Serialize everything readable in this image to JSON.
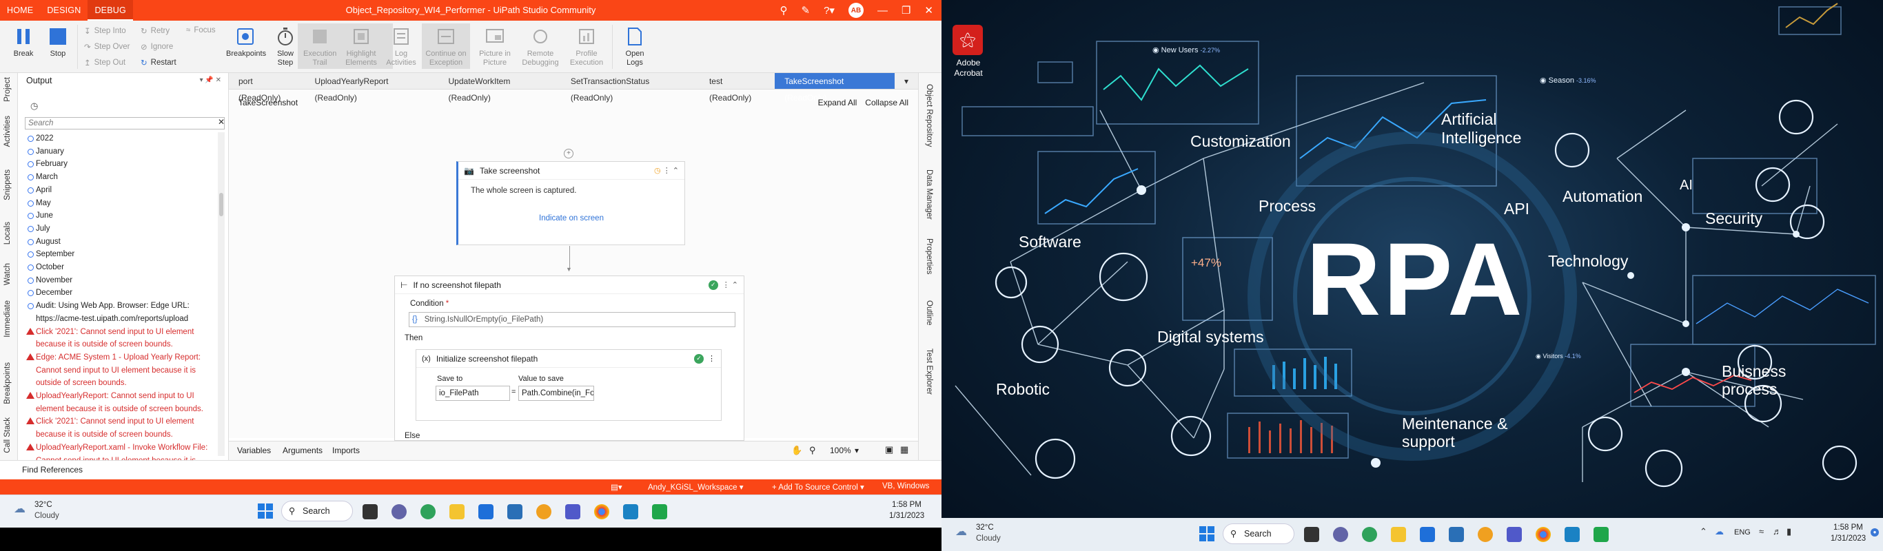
{
  "studio": {
    "tabs": [
      "HOME",
      "DESIGN",
      "DEBUG"
    ],
    "title": "Object_Repository_WI4_Performer - UiPath Studio Community",
    "avatar": "AB",
    "ribbon": {
      "break": "Break",
      "stop": "Stop",
      "step_into": "Step Into",
      "step_over": "Step Over",
      "step_out": "Step Out",
      "retry": "Retry",
      "ignore": "Ignore",
      "restart": "Restart",
      "focus": "Focus",
      "breakpoints": "Breakpoints",
      "slow_step": "Slow Step",
      "execution_trail": "Execution Trail",
      "highlight_elements": "Highlight Elements",
      "log_activities": "Log Activities",
      "continue_on_exception": "Continue on Exception",
      "picture_in_picture": "Picture in Picture",
      "remote_debugging": "Remote Debugging",
      "profile_execution": "Profile Execution",
      "open_logs": "Open Logs"
    },
    "sidebar_left": [
      "Project",
      "Activities",
      "Snippets",
      "Locals",
      "Watch",
      "Immediate",
      "Breakpoints",
      "Call Stack"
    ],
    "sidebar_right": [
      "Object Repository",
      "Data Manager",
      "Properties",
      "Outline",
      "Test Explorer"
    ],
    "output": {
      "title": "Output",
      "search_placeholder": "Search",
      "lines": [
        {
          "t": "2022",
          "k": "i"
        },
        {
          "t": "January",
          "k": "i"
        },
        {
          "t": "February",
          "k": "i"
        },
        {
          "t": "March",
          "k": "i"
        },
        {
          "t": "April",
          "k": "i"
        },
        {
          "t": "May",
          "k": "i"
        },
        {
          "t": "June",
          "k": "i"
        },
        {
          "t": "July",
          "k": "i"
        },
        {
          "t": "August",
          "k": "i"
        },
        {
          "t": "September",
          "k": "i"
        },
        {
          "t": "October",
          "k": "i"
        },
        {
          "t": "November",
          "k": "i"
        },
        {
          "t": "December",
          "k": "i"
        },
        {
          "t": "Audit: Using Web App. Browser: Edge URL: https://acme-test.uipath.com/reports/upload",
          "k": "i"
        },
        {
          "t": "Click '2021': Cannot send input to UI element because it is outside of screen bounds.",
          "k": "e"
        },
        {
          "t": "Edge: ACME System 1 - Upload Yearly Report: Cannot send input to UI element because it is outside of screen bounds.",
          "k": "e"
        },
        {
          "t": "UploadYearlyReport: Cannot send input to UI element because it is outside of screen bounds.",
          "k": "e"
        },
        {
          "t": "Click '2021': Cannot send input to UI element because it is outside of screen bounds.",
          "k": "e"
        },
        {
          "t": "UploadYearlyReport.xaml - Invoke Workflow File: Cannot send input to UI element because it is outside of screen bounds.",
          "k": "e"
        }
      ]
    },
    "doc_tabs": [
      "port (ReadOnly)",
      "UploadYearlyReport (ReadOnly)",
      "UpdateWorkItem (ReadOnly)",
      "SetTransactionStatus (ReadOnly)",
      "test (ReadOnly)",
      "TakeScreenshot (ReadOnly)"
    ],
    "breadcrumb": "TakeScreenshot",
    "expand_all": "Expand All",
    "collapse_all": "Collapse All",
    "take_screenshot": {
      "title": "Take screenshot",
      "desc": "The whole screen is captured.",
      "link": "Indicate on screen"
    },
    "if_block": {
      "title": "If no screenshot filepath",
      "condition_label": "Condition",
      "condition_value": "String.IsNullOrEmpty(io_FilePath)",
      "then": "Then",
      "else": "Else"
    },
    "assign": {
      "title": "Initialize screenshot filepath",
      "save_to_label": "Save to",
      "value_label": "Value to save",
      "save_to": "io_FilePath",
      "eq": "=",
      "value": "Path.Combine(in_Folder, \"Excepti"
    },
    "bottom_tabs": [
      "Variables",
      "Arguments",
      "Imports"
    ],
    "zoom": "100%",
    "find_references": "Find References",
    "status": {
      "workspace": "Andy_KGiSL_Workspace",
      "source_control": "Add To Source Control",
      "lang": "VB, Windows"
    },
    "taskbar": {
      "temp": "32°C",
      "weather": "Cloudy",
      "search": "Search",
      "time": "1:58 PM",
      "date": "1/31/2023"
    }
  },
  "desktop": {
    "acrobat_label": "Adobe Acrobat",
    "big_text": "RPA",
    "labels": [
      "Customization",
      "Artificial Intelligence",
      "Process",
      "API",
      "Automation",
      "AI",
      "Security",
      "Software",
      "Technology",
      "Digital systems",
      "Robotic",
      "Meintenance & support",
      "Buisness process"
    ],
    "widgets": {
      "new_users": "New Users",
      "new_users_delta": "-2.27%",
      "season": "Season",
      "season_delta": "-3.16%",
      "visitors": "Visitors",
      "visitors_delta": "-4.1%",
      "pct": "+47%"
    },
    "taskbar": {
      "temp": "32°C",
      "weather": "Cloudy",
      "search": "Search",
      "lang": "ENG",
      "time": "1:58 PM",
      "date": "1/31/2023"
    }
  }
}
